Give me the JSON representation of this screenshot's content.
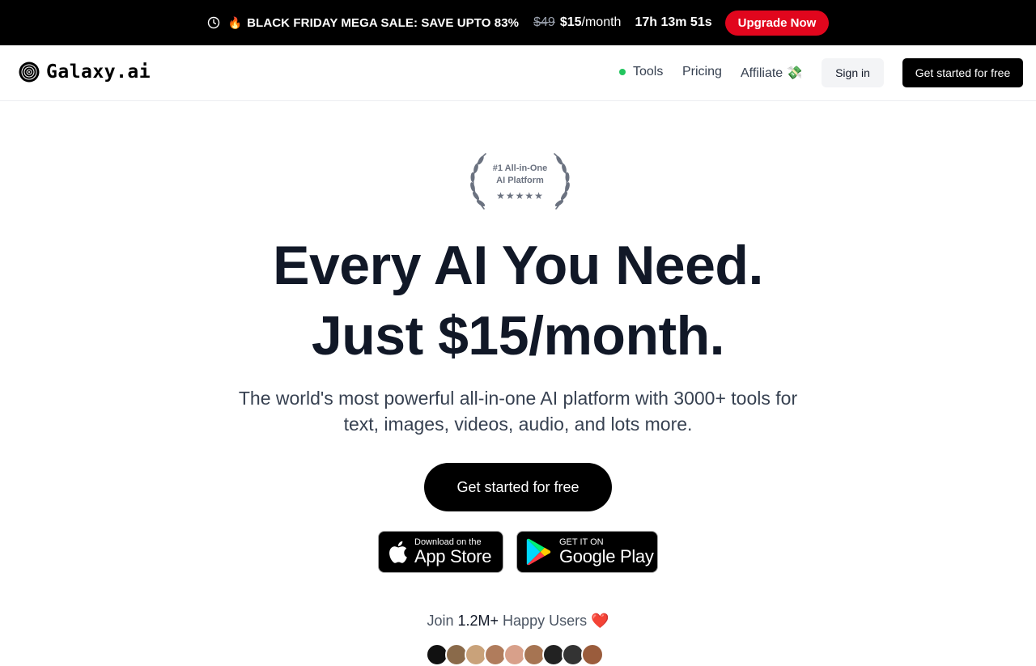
{
  "promo": {
    "sale_label": "BLACK FRIDAY MEGA SALE: SAVE UPTO 83%",
    "old_price": "$49",
    "new_price": "$15",
    "period": "/month",
    "countdown": "17h 13m 51s",
    "upgrade_label": "Upgrade Now",
    "icons": {
      "clock": "clock-icon",
      "fire": "fire-icon"
    },
    "colors": {
      "background": "#000000",
      "upgrade": "#e1061d"
    }
  },
  "nav": {
    "brand": "Galaxy.ai",
    "links": [
      {
        "label": "Tools",
        "indicator": "green-dot"
      },
      {
        "label": "Pricing"
      },
      {
        "label": "Affiliate 💸"
      }
    ],
    "signin_label": "Sign in",
    "cta_label": "Get started for free"
  },
  "hero": {
    "badge_line1": "#1 All-in-One",
    "badge_line2": "AI Platform",
    "badge_stars": "★★★★★",
    "headline_line1": "Every AI You Need.",
    "headline_line2": "Just $15/month.",
    "subtitle": "The world's most powerful all-in-one AI platform with 3000+ tools for text, images, videos, audio, and lots more.",
    "cta_label": "Get started for free",
    "app_store": {
      "small": "Download on the",
      "big": "App Store"
    },
    "google_play": {
      "small": "GET IT ON",
      "big": "Google Play"
    },
    "join_prefix": "Join ",
    "join_count": "1.2M+",
    "join_suffix": " Happy Users ",
    "join_heart": "❤️"
  }
}
